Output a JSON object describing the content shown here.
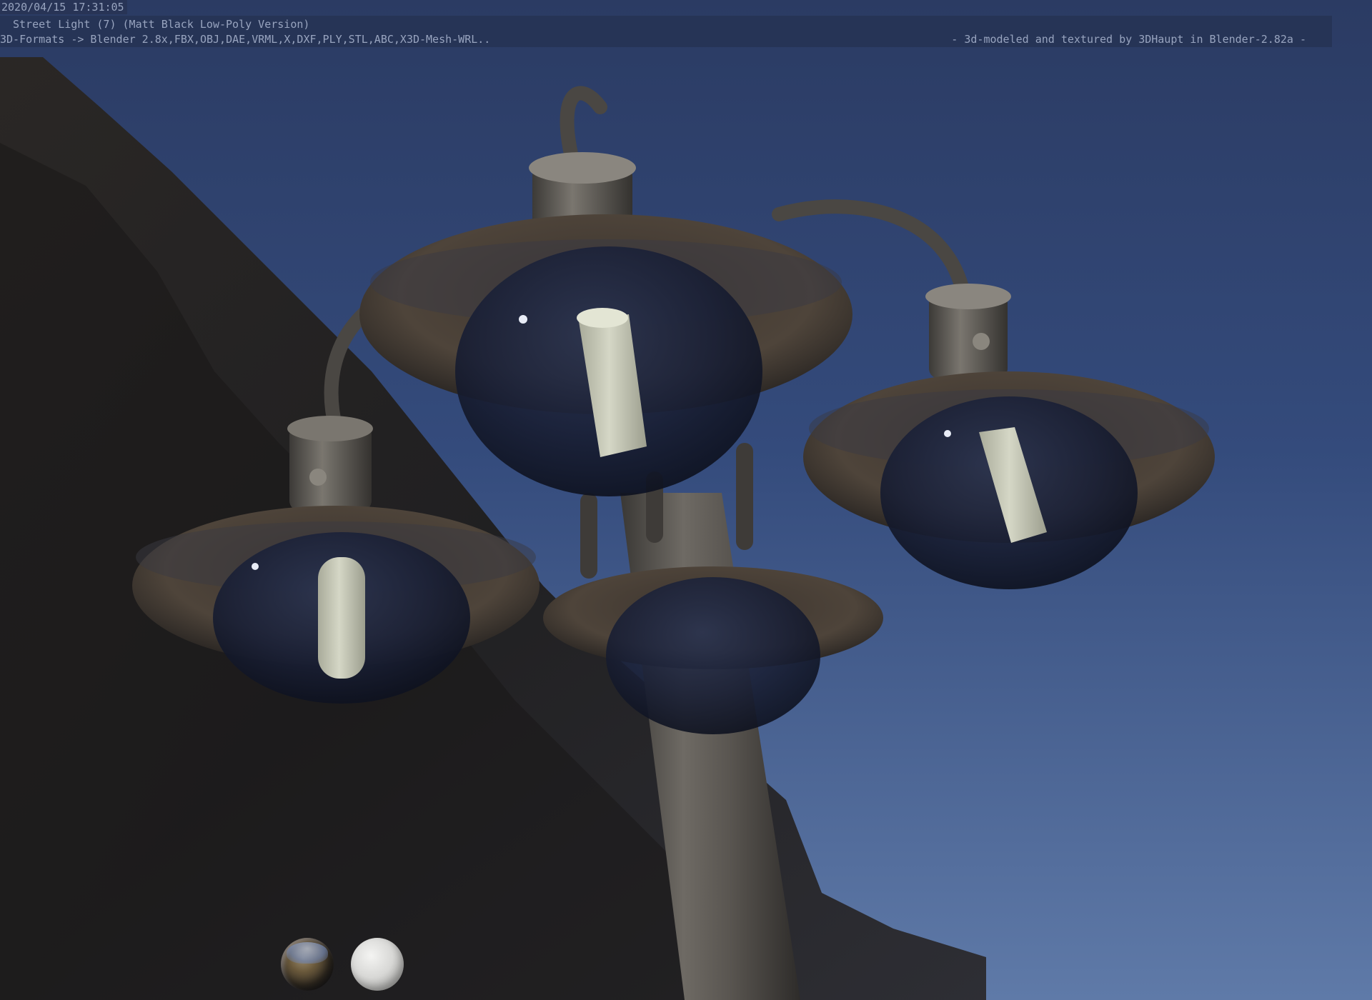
{
  "overlay": {
    "timestamp": "2020/04/15 17:31:05",
    "title": "Street Light (7) (Matt Black Low-Poly Version)",
    "formats": "3D-Formats -> Blender 2.8x,FBX,OBJ,DAE,VRML,X,DXF,PLY,STL,ABC,X3D-Mesh-WRL..",
    "credit": "-  3d-modeled and textured by 3DHaupt in Blender-2.82a -"
  },
  "viewport": {
    "lighting_previews": [
      {
        "name": "hdri-world-preview",
        "icon": "hdri-sphere-icon"
      },
      {
        "name": "matcap-white-preview",
        "icon": "white-sphere-icon"
      }
    ]
  },
  "colors": {
    "sky_top": "#2c3d66",
    "sky_bottom": "#5c77a6",
    "metal": "#5e5a55",
    "bulb": "#c9cbb8",
    "overlay_text": "#98a4bf"
  }
}
